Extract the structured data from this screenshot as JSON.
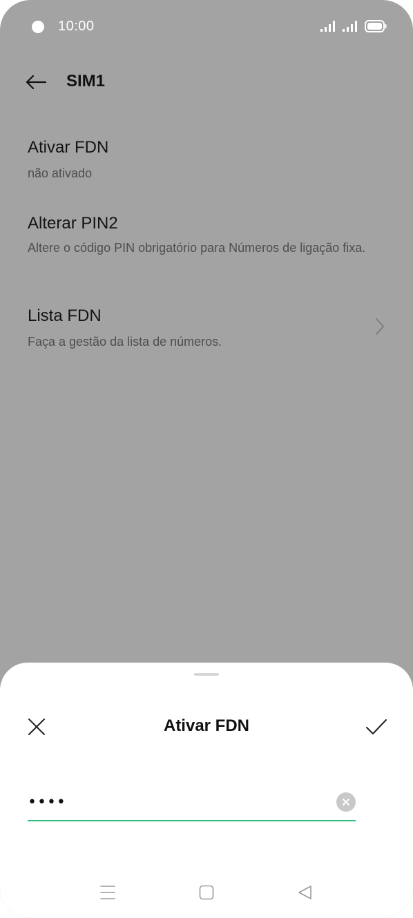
{
  "status_bar": {
    "time": "10:00"
  },
  "top_bar": {
    "title": "SIM1"
  },
  "settings": [
    {
      "title": "Ativar FDN",
      "subtitle": "não ativado"
    },
    {
      "title": "Alterar PIN2",
      "subtitle": "Altere o código PIN obrigatório para Números de ligação fixa."
    },
    {
      "title": "Lista FDN",
      "subtitle": "Faça a gestão da lista de números."
    }
  ],
  "sheet": {
    "title": "Ativar FDN",
    "pin_value": "••••"
  },
  "colors": {
    "accent": "#2fbf7a",
    "scrim_background": "#a3a3a3"
  }
}
